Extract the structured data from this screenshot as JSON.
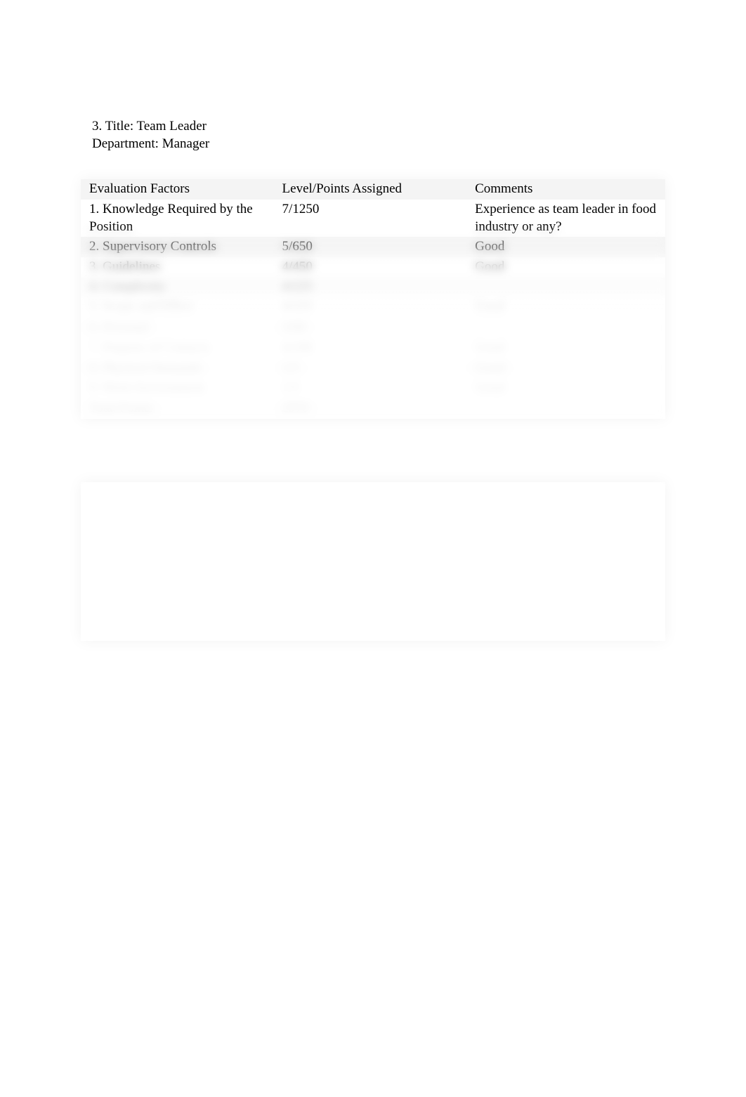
{
  "header": {
    "line1": "3. Title: Team Leader",
    "line2": "Department: Manager"
  },
  "table1": {
    "columns": [
      "Evaluation Factors",
      "Level/Points Assigned",
      "Comments"
    ],
    "rows": [
      {
        "factor": "1. Knowledge Required by the Position",
        "points": "7/1250",
        "comment": "Experience as team leader in food industry or any?"
      },
      {
        "factor": "2. Supervisory Controls",
        "points": "5/650",
        "comment": "Good"
      },
      {
        "factor": "3. Guidelines",
        "points": "4/450",
        "comment": "Good"
      },
      {
        "factor": "4. Complexity",
        "points": "4/225",
        "comment": ""
      },
      {
        "factor": "5. Scope and Effect",
        "points": "4/225",
        "comment": "Good"
      },
      {
        "factor": "6. Personal",
        "points": "3/60",
        "comment": ""
      },
      {
        "factor": "7. Purpose of Contacts",
        "points": "4/100",
        "comment": "Good"
      },
      {
        "factor": "8. Physical Demands",
        "points": "1/5",
        "comment": "Good"
      },
      {
        "factor": "9. Work Environment",
        "points": "1/5",
        "comment": "Good"
      },
      {
        "factor": "Total Points",
        "points": "2970",
        "comment": ""
      }
    ]
  },
  "table2": {
    "rows": [
      {
        "a": "",
        "b": "",
        "c": ""
      },
      {
        "a": "",
        "b": "",
        "c": ""
      },
      {
        "a": "",
        "b": "",
        "c": ""
      },
      {
        "a": "",
        "b": "",
        "c": ""
      },
      {
        "a": "",
        "b": "",
        "c": ""
      },
      {
        "a": "",
        "b": "",
        "c": ""
      },
      {
        "a": "",
        "b": "",
        "c": ""
      },
      {
        "a": "",
        "b": "",
        "c": ""
      },
      {
        "a": "",
        "b": "",
        "c": ""
      },
      {
        "a": "",
        "b": "",
        "c": ""
      },
      {
        "a": "",
        "b": "",
        "c": ""
      },
      {
        "a": "",
        "b": "",
        "c": ""
      }
    ]
  }
}
